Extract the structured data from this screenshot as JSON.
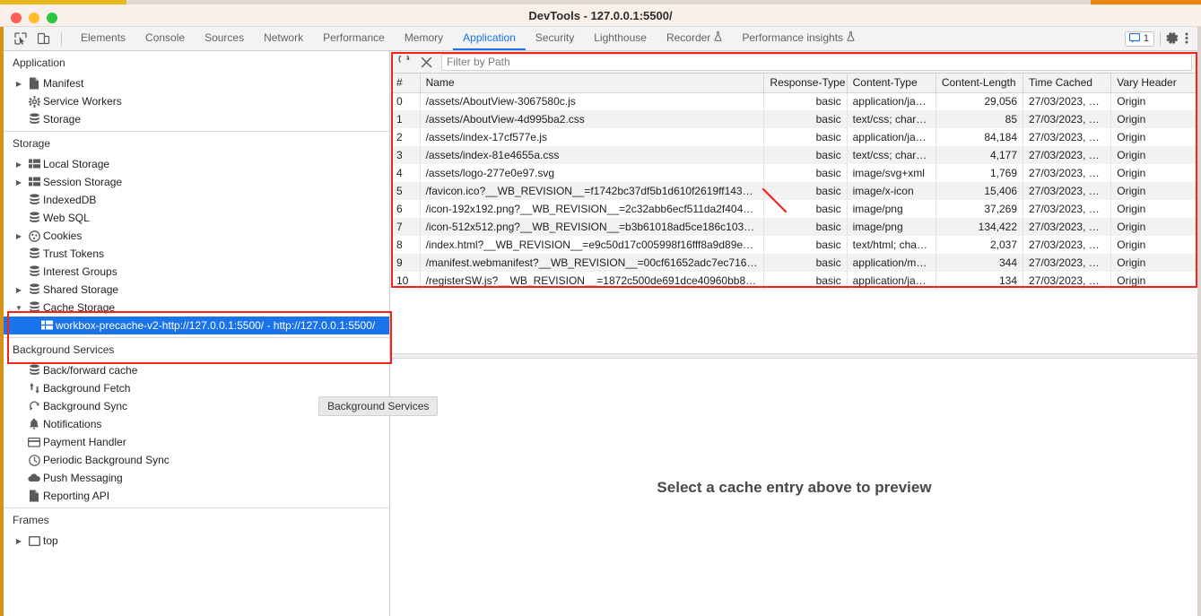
{
  "window": {
    "title": "DevTools - 127.0.0.1:5500/",
    "traffic_lights": [
      "close-button",
      "minimize-button",
      "zoom-button"
    ]
  },
  "tabbar": {
    "left_icons": [
      {
        "name": "inspect-element-icon",
        "glyph": "⬚"
      },
      {
        "name": "device-toolbar-icon",
        "glyph": "▭"
      }
    ],
    "tabs": [
      {
        "label": "Elements",
        "active": false,
        "experimental": false
      },
      {
        "label": "Console",
        "active": false,
        "experimental": false
      },
      {
        "label": "Sources",
        "active": false,
        "experimental": false
      },
      {
        "label": "Network",
        "active": false,
        "experimental": false
      },
      {
        "label": "Performance",
        "active": false,
        "experimental": false
      },
      {
        "label": "Memory",
        "active": false,
        "experimental": false
      },
      {
        "label": "Application",
        "active": true,
        "experimental": false
      },
      {
        "label": "Security",
        "active": false,
        "experimental": false
      },
      {
        "label": "Lighthouse",
        "active": false,
        "experimental": false
      },
      {
        "label": "Recorder",
        "active": false,
        "experimental": true
      },
      {
        "label": "Performance insights",
        "active": false,
        "experimental": true
      }
    ],
    "experimental_glyph": "⚗",
    "message_count": "1",
    "message_icon": "message-icon",
    "settings_icon": "gear-icon",
    "more_icon": "kebab-menu-icon",
    "accent_color": "#1a73e8"
  },
  "sidebar": {
    "sections": [
      {
        "title": "Application",
        "items": [
          {
            "label": "Manifest",
            "icon": "document-icon",
            "glyph": "὜b",
            "arrow": true,
            "indent": 1
          },
          {
            "label": "Service Workers",
            "icon": "gear-icon",
            "glyph": "⚙",
            "arrow": false,
            "indent": 1
          },
          {
            "label": "Storage",
            "icon": "database-icon",
            "glyph": "≡",
            "arrow": false,
            "indent": 1
          }
        ]
      },
      {
        "title": "Storage",
        "items": [
          {
            "label": "Local Storage",
            "icon": "table-icon",
            "glyph": "▦",
            "arrow": true,
            "indent": 1
          },
          {
            "label": "Session Storage",
            "icon": "table-icon",
            "glyph": "▦",
            "arrow": true,
            "indent": 1
          },
          {
            "label": "IndexedDB",
            "icon": "database-icon",
            "glyph": "≡",
            "arrow": false,
            "indent": 1
          },
          {
            "label": "Web SQL",
            "icon": "database-icon",
            "glyph": "≡",
            "arrow": false,
            "indent": 1
          },
          {
            "label": "Cookies",
            "icon": "cookie-icon",
            "glyph": "●",
            "arrow": true,
            "indent": 1
          },
          {
            "label": "Trust Tokens",
            "icon": "database-icon",
            "glyph": "≡",
            "arrow": false,
            "indent": 1
          },
          {
            "label": "Interest Groups",
            "icon": "database-icon",
            "glyph": "≡",
            "arrow": false,
            "indent": 1
          },
          {
            "label": "Shared Storage",
            "icon": "database-icon",
            "glyph": "≡",
            "arrow": true,
            "indent": 1
          },
          {
            "label": "Cache Storage",
            "icon": "database-icon",
            "glyph": "≡",
            "arrow": true,
            "expanded": true,
            "indent": 1
          },
          {
            "label": "workbox-precache-v2-http://127.0.0.1:5500/ - http://127.0.0.1:5500/",
            "icon": "table-icon",
            "glyph": "▦",
            "arrow": false,
            "indent": 2,
            "selected": true
          }
        ]
      },
      {
        "title": "Background Services",
        "items": [
          {
            "label": "Back/forward cache",
            "icon": "database-icon",
            "glyph": "≡",
            "arrow": false,
            "indent": 1
          },
          {
            "label": "Background Fetch",
            "icon": "arrows-up-down-icon",
            "glyph": "⇅",
            "arrow": false,
            "indent": 1
          },
          {
            "label": "Background Sync",
            "icon": "sync-icon",
            "glyph": "↻",
            "arrow": false,
            "indent": 1
          },
          {
            "label": "Notifications",
            "icon": "bell-icon",
            "glyph": "ὑ4",
            "arrow": false,
            "indent": 1
          },
          {
            "label": "Payment Handler",
            "icon": "credit-card-icon",
            "glyph": "▭",
            "arrow": false,
            "indent": 1
          },
          {
            "label": "Periodic Background Sync",
            "icon": "clock-icon",
            "glyph": "○",
            "arrow": false,
            "indent": 1
          },
          {
            "label": "Push Messaging",
            "icon": "cloud-icon",
            "glyph": "☁",
            "arrow": false,
            "indent": 1
          },
          {
            "label": "Reporting API",
            "icon": "document-icon",
            "glyph": "὜b",
            "arrow": false,
            "indent": 1
          }
        ]
      },
      {
        "title": "Frames",
        "items": [
          {
            "label": "top",
            "icon": "frame-icon",
            "glyph": "▭",
            "arrow": true,
            "indent": 1
          }
        ]
      }
    ],
    "selection_color": "#1a73e8"
  },
  "tooltip": {
    "text": "Background Services"
  },
  "filterbar": {
    "refresh_icon": "refresh-icon",
    "clear_icon": "clear-icon",
    "placeholder": "Filter by Path",
    "value": ""
  },
  "table": {
    "columns": [
      "#",
      "Name",
      "Response-Type",
      "Content-Type",
      "Content-Length",
      "Time Cached",
      "Vary Header"
    ],
    "rows": [
      {
        "index": "0",
        "name": "/assets/AboutView-3067580c.js",
        "response_type": "basic",
        "content_type": "application/ja…",
        "content_length": "29,056",
        "time_cached": "27/03/2023, …",
        "vary_header": "Origin"
      },
      {
        "index": "1",
        "name": "/assets/AboutView-4d995ba2.css",
        "response_type": "basic",
        "content_type": "text/css; char…",
        "content_length": "85",
        "time_cached": "27/03/2023, …",
        "vary_header": "Origin"
      },
      {
        "index": "2",
        "name": "/assets/index-17cf577e.js",
        "response_type": "basic",
        "content_type": "application/ja…",
        "content_length": "84,184",
        "time_cached": "27/03/2023, …",
        "vary_header": "Origin"
      },
      {
        "index": "3",
        "name": "/assets/index-81e4655a.css",
        "response_type": "basic",
        "content_type": "text/css; char…",
        "content_length": "4,177",
        "time_cached": "27/03/2023, …",
        "vary_header": "Origin"
      },
      {
        "index": "4",
        "name": "/assets/logo-277e0e97.svg",
        "response_type": "basic",
        "content_type": "image/svg+xml",
        "content_length": "1,769",
        "time_cached": "27/03/2023, …",
        "vary_header": "Origin"
      },
      {
        "index": "5",
        "name": "/favicon.ico?__WB_REVISION__=f1742bc37df5b1d610f2619ff143…",
        "response_type": "basic",
        "content_type": "image/x-icon",
        "content_length": "15,406",
        "time_cached": "27/03/2023, …",
        "vary_header": "Origin"
      },
      {
        "index": "6",
        "name": "/icon-192x192.png?__WB_REVISION__=2c32abb6ecf511da2f404…",
        "response_type": "basic",
        "content_type": "image/png",
        "content_length": "37,269",
        "time_cached": "27/03/2023, …",
        "vary_header": "Origin"
      },
      {
        "index": "7",
        "name": "/icon-512x512.png?__WB_REVISION__=b3b61018ad5ce186c103…",
        "response_type": "basic",
        "content_type": "image/png",
        "content_length": "134,422",
        "time_cached": "27/03/2023, …",
        "vary_header": "Origin"
      },
      {
        "index": "8",
        "name": "/index.html?__WB_REVISION__=e9c50d17c005998f16fff8a9d89e…",
        "response_type": "basic",
        "content_type": "text/html; cha…",
        "content_length": "2,037",
        "time_cached": "27/03/2023, …",
        "vary_header": "Origin"
      },
      {
        "index": "9",
        "name": "/manifest.webmanifest?__WB_REVISION__=00cf61652adc7ec716…",
        "response_type": "basic",
        "content_type": "application/m…",
        "content_length": "344",
        "time_cached": "27/03/2023, …",
        "vary_header": "Origin"
      },
      {
        "index": "10",
        "name": "/registerSW.js?__WB_REVISION__=1872c500de691dce40960bb8…",
        "response_type": "basic",
        "content_type": "application/ja…",
        "content_length": "134",
        "time_cached": "27/03/2023, …",
        "vary_header": "Origin"
      }
    ]
  },
  "preview": {
    "empty_text": "Select a cache entry above to preview"
  },
  "annotations": {
    "highlight_color": "#f4241d",
    "boxes": [
      "cache-storage-tree-section",
      "cache-entries-table"
    ],
    "arrow": "pointer-to-row-5"
  }
}
